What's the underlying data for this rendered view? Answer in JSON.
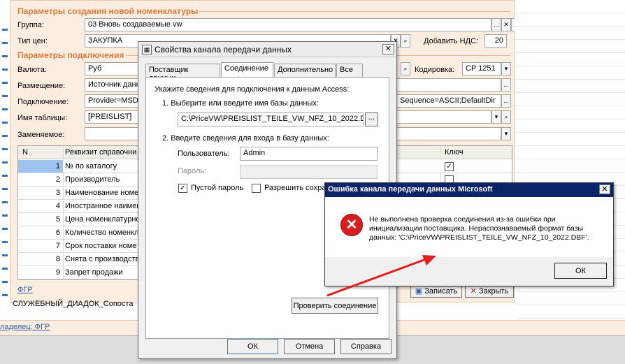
{
  "bg": {
    "sec1": "Параметры создания новой номенклатуры",
    "group_label": "Группа:",
    "group_value": "03 Вновь создаваемые vw",
    "price_label": "Тип цен:",
    "price_value": "ЗАКУПКА",
    "vat_label": "Добавить НДС:",
    "vat_value": "20",
    "sec2": "Параметры подключения",
    "currency_label": "Валюта:",
    "currency_value": "Руб",
    "encoding_label": "Кодировка:",
    "encoding_value": "CP 1251",
    "placement_label": "Размещение:",
    "placement_value": "Источник данн",
    "connection_label": "Подключение:",
    "connection_value": "Provider=MSDA",
    "connection_tail": "Sequence=ASCII;DefaultDir",
    "table_label": "Имя таблицы:",
    "table_value": "[PREISLIST]",
    "replaced_label": "Заменяемое:",
    "col_n": "N",
    "col_req": "Реквизит справочни",
    "col_key": "Ключ",
    "rows": [
      {
        "n": "1",
        "t": "№ по каталогу"
      },
      {
        "n": "2",
        "t": "Производитель"
      },
      {
        "n": "3",
        "t": "Наименование номе"
      },
      {
        "n": "4",
        "t": "Иностранное наимен"
      },
      {
        "n": "5",
        "t": "Цена номенклатурно"
      },
      {
        "n": "6",
        "t": "Количество номенкл"
      },
      {
        "n": "7",
        "t": "Срок поставки номе"
      },
      {
        "n": "8",
        "t": "Снята с производств"
      },
      {
        "n": "9",
        "t": "Запрет продажи"
      }
    ],
    "fgr": "ФГР",
    "save": "Записать",
    "close": "Закрыть",
    "service": "СЛУЖЕБНЫЙ_ДИАДОК_Сопоста",
    "owner": "ладелец: ФГР"
  },
  "dlg": {
    "title": "Свойства канала передачи данных",
    "tabs": [
      "Поставщик данных",
      "Соединение",
      "Дополнительно",
      "Все"
    ],
    "intro": "Укажите сведения для подключения к данным Access:",
    "step1": "1. Выберите или введите имя базы данных:",
    "db_path": "C:\\PriceVW\\PREISLIST_TEILE_VW_NFZ_10_2022.D",
    "browse": "...",
    "step2": "2. Введите сведения для входа в базу данных:",
    "user_label": "Пользователь:",
    "user_value": "Admin",
    "pass_label": "Пароль:",
    "empty_pass": "Пустой пароль",
    "allow_save": "Разрешить сохра",
    "test": "Проверить соединение",
    "ok": "ОК",
    "cancel": "Отмена",
    "help": "Справка"
  },
  "err": {
    "title": "Ошибка канала передачи данных Microsoft",
    "message": "Не выполнена проверка соединения из-за ошибки при инициализации поставщика. Нераспознаваемый формат базы данных: 'C:\\PriceVW\\PREISLIST_TEILE_VW_NFZ_10_2022.DBF'.",
    "ok": "ОК"
  },
  "colors": {
    "accent": "#e07a3a",
    "titlebar": "#0a246a",
    "arrow": "#e0201c",
    "error": "#d81e1e"
  }
}
